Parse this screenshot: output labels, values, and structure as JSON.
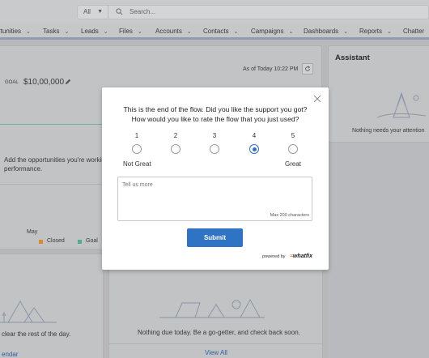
{
  "header": {
    "search_scope": "All",
    "search_placeholder": "Search..."
  },
  "nav": {
    "items": [
      {
        "label": "rtunities"
      },
      {
        "label": "Tasks"
      },
      {
        "label": "Leads"
      },
      {
        "label": "Files"
      },
      {
        "label": "Accounts"
      },
      {
        "label": "Contacts"
      },
      {
        "label": "Campaigns"
      },
      {
        "label": "Dashboards"
      },
      {
        "label": "Reports"
      },
      {
        "label": "Chatter"
      }
    ]
  },
  "background": {
    "as_of": "As of Today 10:22 PM",
    "goal_label": "GOAL",
    "goal_value": "$10,00,000",
    "add_opps_line1": "Add the opportunities you're working",
    "add_opps_line2": "performance.",
    "month_label": "May",
    "legend_closed": "Closed",
    "legend_goal": "Goal",
    "assistant_title": "Assistant",
    "assistant_empty": "Nothing needs your attention",
    "tasks_clear": "clear the rest of the day.",
    "events_empty": "Nothing due today. Be a go-getter, and check back soon.",
    "view_all": "View All",
    "calendar_link": "endar",
    "colors": {
      "closed": "#e0872e",
      "goal": "#4caf8e",
      "nav_underline": "#8e9eb1"
    }
  },
  "survey": {
    "question_line1": "This is the end of the flow. Did you like the support you got?",
    "question_line2": "How would you like to rate the flow that you just used?",
    "options": [
      {
        "label": "1",
        "selected": false
      },
      {
        "label": "2",
        "selected": false
      },
      {
        "label": "3",
        "selected": false
      },
      {
        "label": "4",
        "selected": true
      },
      {
        "label": "5",
        "selected": false
      }
    ],
    "scale_low": "Not Great",
    "scale_high": "Great",
    "comment_placeholder": "Tell us more",
    "char_limit": "Max 200 characters",
    "submit_label": "Submit",
    "powered_by": "powered by",
    "brand": "whatfix",
    "accent_color": "#2f74c4"
  }
}
